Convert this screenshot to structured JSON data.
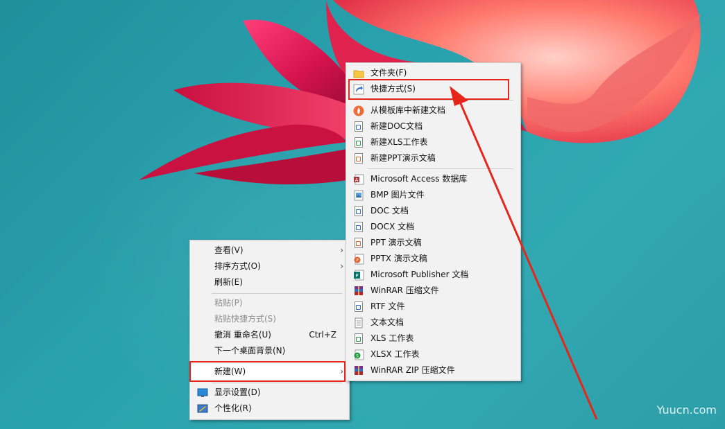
{
  "context_menu": {
    "items": [
      {
        "label": "查看(V)",
        "has_submenu": true,
        "enabled": true
      },
      {
        "label": "排序方式(O)",
        "has_submenu": true,
        "enabled": true
      },
      {
        "label": "刷新(E)",
        "enabled": true
      },
      {
        "label": "粘贴(P)",
        "enabled": false
      },
      {
        "label": "粘贴快捷方式(S)",
        "enabled": false
      },
      {
        "label": "撤消 重命名(U)",
        "shortcut": "Ctrl+Z",
        "enabled": true
      },
      {
        "label": "下一个桌面背景(N)",
        "enabled": true
      },
      {
        "label": "新建(W)",
        "has_submenu": true,
        "enabled": true,
        "highlighted": true
      },
      {
        "label": "显示设置(D)",
        "icon": "display-icon",
        "enabled": true
      },
      {
        "label": "个性化(R)",
        "icon": "personalize-icon",
        "enabled": true
      }
    ],
    "arrow": "›"
  },
  "new_submenu": {
    "items": [
      {
        "label": "文件夹(F)",
        "icon": "folder-icon"
      },
      {
        "label": "快捷方式(S)",
        "icon": "shortcut-icon",
        "highlighted": true
      },
      {
        "label": "从模板库中新建文档",
        "icon": "wps-template-icon"
      },
      {
        "label": "新建DOC文档",
        "icon": "doc-icon"
      },
      {
        "label": "新建XLS工作表",
        "icon": "xls-icon"
      },
      {
        "label": "新建PPT演示文稿",
        "icon": "ppt-icon"
      },
      {
        "label": "Microsoft Access 数据库",
        "icon": "access-icon"
      },
      {
        "label": "BMP 图片文件",
        "icon": "bmp-icon"
      },
      {
        "label": "DOC 文档",
        "icon": "doc-icon"
      },
      {
        "label": "DOCX 文档",
        "icon": "docx-icon"
      },
      {
        "label": "PPT 演示文稿",
        "icon": "ppt-icon"
      },
      {
        "label": "PPTX 演示文稿",
        "icon": "pptx-icon"
      },
      {
        "label": "Microsoft Publisher 文档",
        "icon": "publisher-icon"
      },
      {
        "label": "WinRAR 压缩文件",
        "icon": "winrar-icon"
      },
      {
        "label": "RTF 文件",
        "icon": "rtf-icon"
      },
      {
        "label": "文本文档",
        "icon": "txt-icon"
      },
      {
        "label": "XLS 工作表",
        "icon": "xls-icon"
      },
      {
        "label": "XLSX 工作表",
        "icon": "xlsx-icon"
      },
      {
        "label": "WinRAR ZIP 压缩文件",
        "icon": "winrar-zip-icon"
      }
    ]
  },
  "colors": {
    "annotation_red": "#e6261a",
    "menu_bg": "#f2f2f2",
    "doc_blue": "#2b6cc4",
    "xls_green": "#1f9a3e",
    "ppt_orange": "#e2622a"
  },
  "watermark": "Yuucn.com"
}
